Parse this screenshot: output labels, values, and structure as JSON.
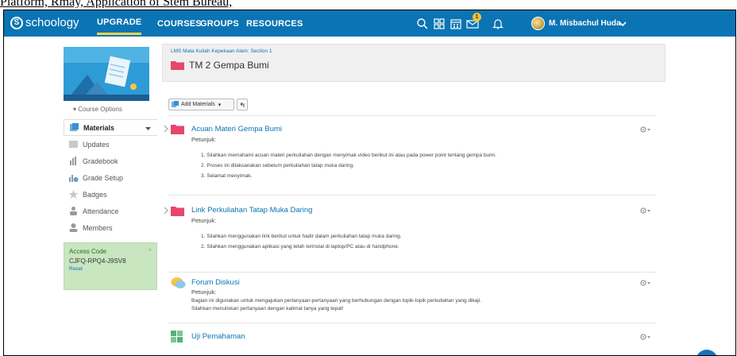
{
  "caption": "Platform, Rmay, Application of Stem Bureau,",
  "header": {
    "logo": "schoology",
    "nav": [
      "UPGRADE",
      "COURSES",
      "GROUPS",
      "RESOURCES"
    ],
    "badge_count": "1",
    "username": "M. Misbachul Huda"
  },
  "sidebar": {
    "course_options": "Course Options",
    "items": [
      {
        "label": "Materials"
      },
      {
        "label": "Updates"
      },
      {
        "label": "Gradebook"
      },
      {
        "label": "Grade Setup"
      },
      {
        "label": "Badges"
      },
      {
        "label": "Attendance"
      },
      {
        "label": "Members"
      }
    ],
    "access": {
      "title": "Access Code",
      "code": "CJFQ-RPQ4-J9SV8",
      "reset": "Reset",
      "close": "×"
    }
  },
  "main": {
    "breadcrumb": "LMS Mata Kuliah Kepekaan Alam: Section 1",
    "title": "TM 2 Gempa Bumi",
    "add_materials": "Add Materials",
    "items": [
      {
        "title": "Acuan Materi Gempa Bumi",
        "sub": "Petunjuk:",
        "lines": [
          "1. Silahkan memahami acuan materi perkuliahan dengan menyimak video berikut ini atau pada power point tentang gempa bumi.",
          "2. Proses ini dilaksanakan sebelum perkuliahan tatap muka daring.",
          "3. Selamat menyimak."
        ]
      },
      {
        "title": "Link Perkuliahan Tatap Muka Daring",
        "sub": "Petunjuk:",
        "lines": [
          "1. Silahkan menggunakan link berikut untuk hadir dalam perkuliahan tatap muka daring.",
          "2. Silahkan menggunakan aplikasi yang telah terinstal di laptop/PC atau di handphone."
        ]
      },
      {
        "title": "Forum Diskusi",
        "sub": "Petunjuk:",
        "lines": [
          "Bagian ini digunakan untuk mengajukan pertanyaan-pertanyaan yang berhubungan dengan topik-topik perkuliahan yang dikaji.",
          "Silahkan menuliskan pertanyaan dengan kalimat tanya yang tepat!"
        ]
      },
      {
        "title": "Uji Pemahaman"
      }
    ]
  },
  "fab": "S",
  "colors": {
    "brand": "#0a74b4",
    "folder": "#e8466b",
    "access_bg": "#c8e6c0"
  }
}
